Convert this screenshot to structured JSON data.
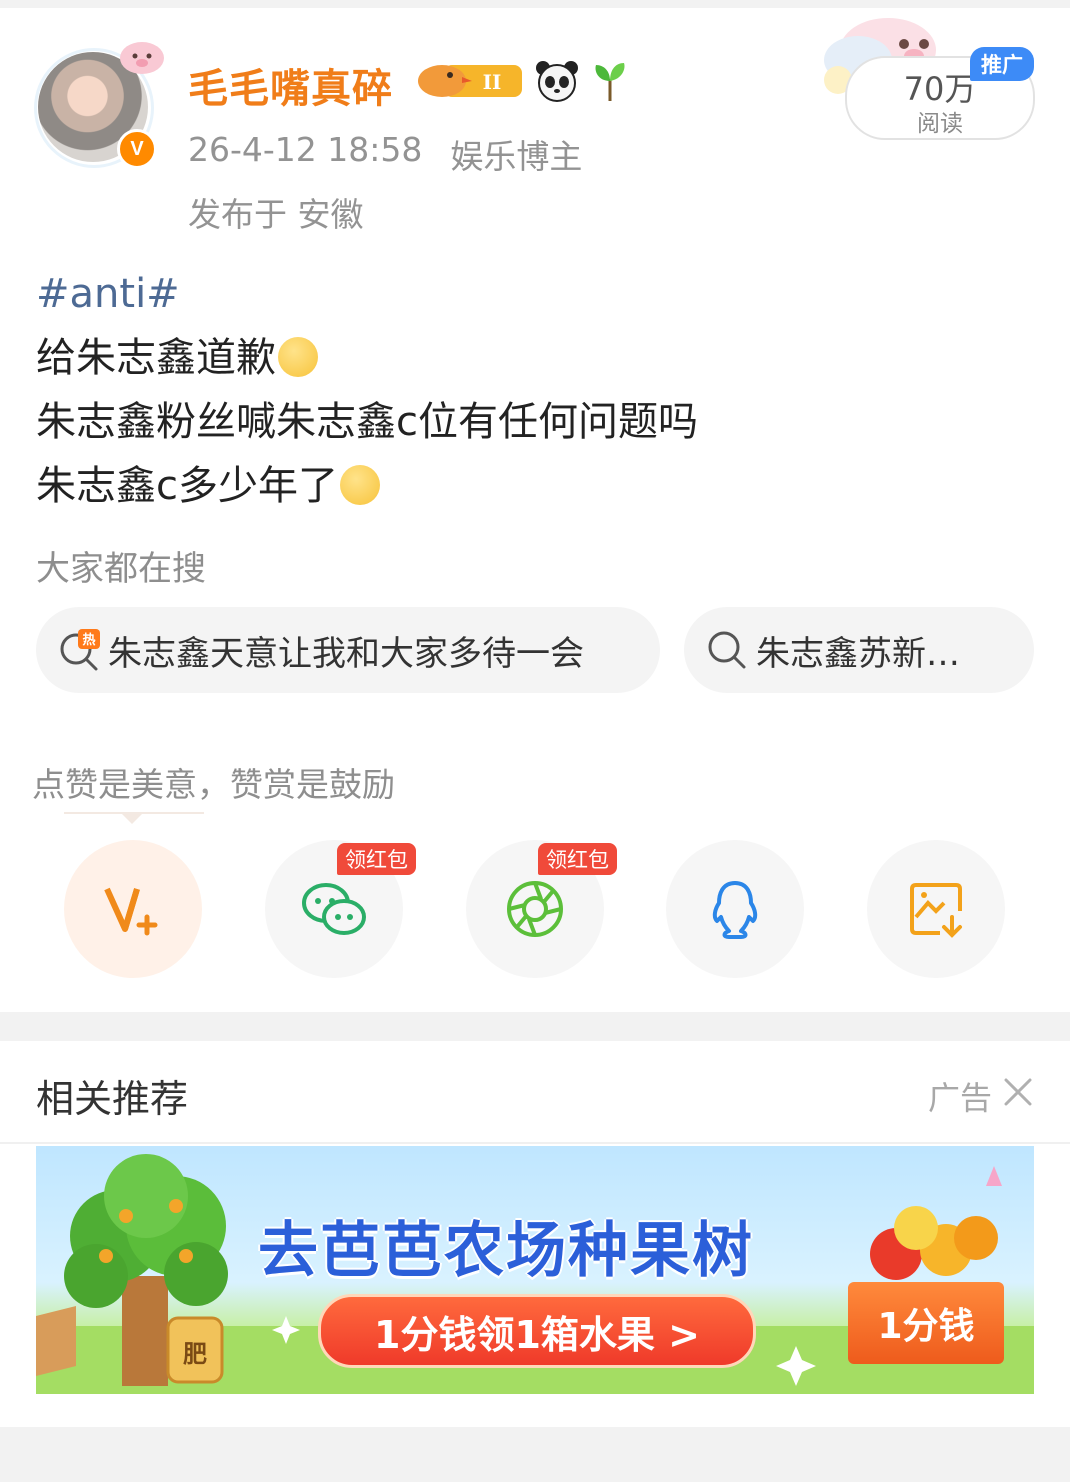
{
  "post": {
    "author": "毛毛嘴真碎",
    "verified_icon": "v-verified-badge",
    "badges": [
      "level-badge-II",
      "panda-icon",
      "sprout-icon"
    ],
    "level_label": "II",
    "timestamp": "26-4-12 18:58",
    "category": "娱乐博主",
    "location": "发布于 安徽",
    "read_count": "70万",
    "read_label": "阅读",
    "promo_tag": "推广",
    "topic": "#anti#",
    "lines": [
      "给朱志鑫道歉",
      "朱志鑫粉丝喊朱志鑫c位有任何问题吗",
      "朱志鑫c多少年了"
    ]
  },
  "search": {
    "heading": "大家都在搜",
    "chips": [
      {
        "icon": "hot-search-icon",
        "label": "朱志鑫天意让我和大家多待一会"
      },
      {
        "icon": "search-icon",
        "label": "朱志鑫苏新…"
      }
    ]
  },
  "reward": {
    "heading": "点赞是美意，赞赏是鼓励",
    "buttons": [
      {
        "name": "reward-v-plus",
        "icon": "v-plus-icon",
        "tag": ""
      },
      {
        "name": "share-wechat",
        "icon": "wechat-icon",
        "tag": "领红包"
      },
      {
        "name": "share-moments",
        "icon": "moments-icon",
        "tag": "领红包"
      },
      {
        "name": "share-qq",
        "icon": "qq-icon",
        "tag": ""
      },
      {
        "name": "save-image",
        "icon": "save-image-icon",
        "tag": ""
      }
    ]
  },
  "recommend": {
    "title": "相关推荐",
    "ad_label": "广告",
    "banner": {
      "title": "去芭芭农场种果树",
      "cta": "1分钱领1箱水果 >",
      "price": "1分钱",
      "fertilizer_label": "肥"
    }
  },
  "colors": {
    "username": "#f07d19",
    "topic_link": "#4d6a94",
    "promo_blue": "#3d8bf7",
    "red_tag": "#f04a3a",
    "banner_title": "#2b5fd9"
  }
}
